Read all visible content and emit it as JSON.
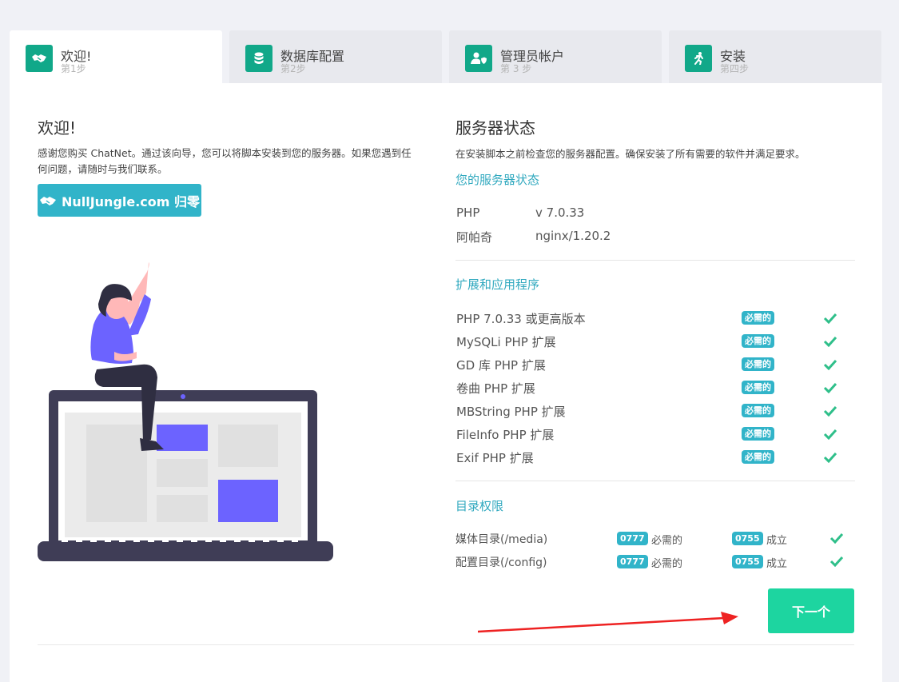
{
  "tabs": [
    {
      "title": "欢迎!",
      "sub": "第1步",
      "icon": "handshake-icon"
    },
    {
      "title": "数据库配置",
      "sub": "第2步",
      "icon": "database-icon"
    },
    {
      "title": "管理员帐户",
      "sub": "第 3 步",
      "icon": "user-shield-icon"
    },
    {
      "title": "安装",
      "sub": "第四步",
      "icon": "running-icon"
    }
  ],
  "welcome": {
    "title": "欢迎!",
    "text": "感谢您购买 ChatNet。通过该向导，您可以将脚本安装到您的服务器。如果您遇到任何问题，请随时与我们联系。",
    "promo_label": "NullJungle.com 归零"
  },
  "server": {
    "title": "服务器状态",
    "desc": "在安装脚本之前检查您的服务器配置。确保安装了所有需要的软件并满足要求。",
    "status_heading": "您的服务器状态",
    "status": [
      {
        "name": "PHP",
        "value": "v 7.0.33"
      },
      {
        "name": "阿帕奇",
        "value": "nginx/1.20.2"
      }
    ],
    "ext_heading": "扩展和应用程序",
    "extensions": [
      {
        "name": "PHP 7.0.33 或更高版本",
        "badge": "必需的"
      },
      {
        "name": "MySQLi PHP 扩展",
        "badge": "必需的"
      },
      {
        "name": "GD 库 PHP 扩展",
        "badge": "必需的"
      },
      {
        "name": "卷曲 PHP 扩展",
        "badge": "必需的"
      },
      {
        "name": "MBString PHP 扩展",
        "badge": "必需的"
      },
      {
        "name": "FileInfo PHP 扩展",
        "badge": "必需的"
      },
      {
        "name": "Exif PHP 扩展",
        "badge": "必需的"
      }
    ],
    "perm_heading": "目录权限",
    "permissions": [
      {
        "name": "媒体目录(/media)",
        "req_code": "0777",
        "req_text": "必需的",
        "cur_code": "0755",
        "cur_text": "成立"
      },
      {
        "name": "配置目录(/config)",
        "req_code": "0777",
        "req_text": "必需的",
        "cur_code": "0755",
        "cur_text": "成立"
      }
    ]
  },
  "next_label": "下一个",
  "colors": {
    "accent": "#11a889",
    "badge": "#31b4c9",
    "next": "#1dd5a0",
    "check": "#2fbf8a",
    "arrow": "#ee2222"
  }
}
